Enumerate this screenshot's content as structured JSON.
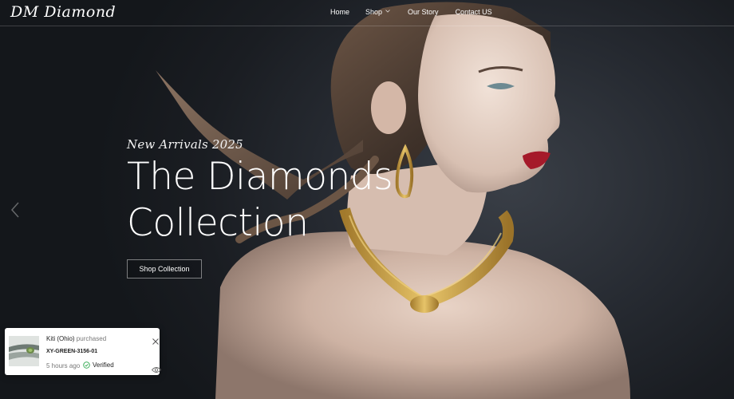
{
  "brand": {
    "logo_text": "DM Diamond"
  },
  "nav": {
    "items": [
      {
        "label": "Home"
      },
      {
        "label": "Shop"
      },
      {
        "label": "Our Story"
      },
      {
        "label": "Contact US"
      }
    ]
  },
  "hero": {
    "eyebrow": "New Arrivals 2025",
    "headline_line1": "The Diamonds",
    "headline_line2": "Collection",
    "cta_label": "Shop Collection"
  },
  "popup": {
    "buyer": "Kiti (Ohio)",
    "action": "purchased",
    "sku": "XY-GREEN-3156-01",
    "time": "5 hours ago",
    "verified_label": "Verified"
  },
  "colors": {
    "background": "#15181c",
    "text": "#ffffff",
    "gold": "#d2a94a",
    "verified_green": "#2fa84f"
  },
  "icons": [
    "chevron-down-icon",
    "chevron-left-icon",
    "close-icon",
    "check-circle-icon",
    "eye-icon"
  ]
}
